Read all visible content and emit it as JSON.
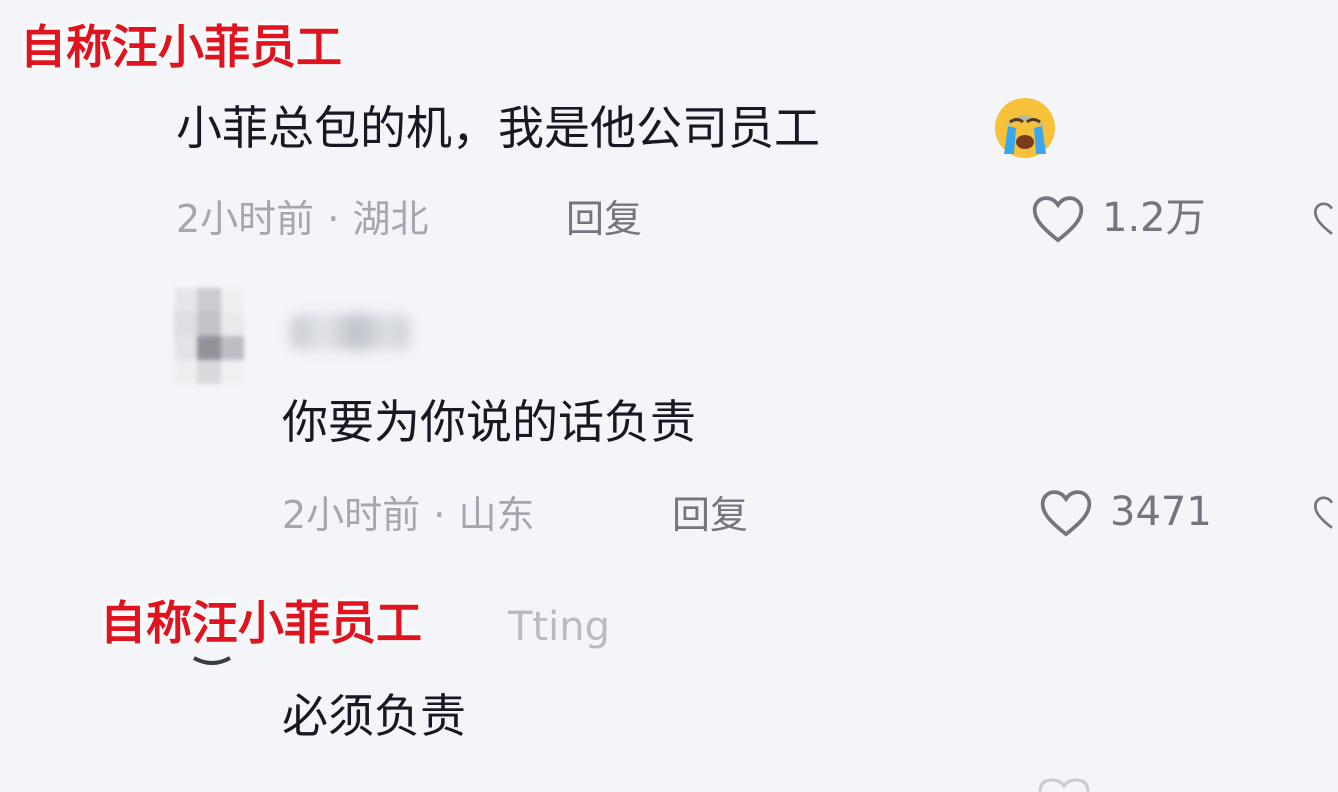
{
  "overlay_label": "自称汪小菲员工",
  "comments": [
    {
      "text": "小菲总包的机，我是他公司员工",
      "emoji_icon": "loudly-crying-face-emoji",
      "time": "2小时前",
      "location": "湖北",
      "reply_label": "回复",
      "likes": "1.2万"
    },
    {
      "username": "",
      "text": "你要为你说的话负责",
      "time": "2小时前",
      "location": "山东",
      "reply_label": "回复",
      "likes": "3471"
    },
    {
      "username": "Tting",
      "text": "必须负责"
    }
  ],
  "separator": "·",
  "colors": {
    "overlay_red": "#e0141e",
    "text_primary": "#161823",
    "text_secondary": "#a4a7b0",
    "background": "#f4f5f8"
  }
}
